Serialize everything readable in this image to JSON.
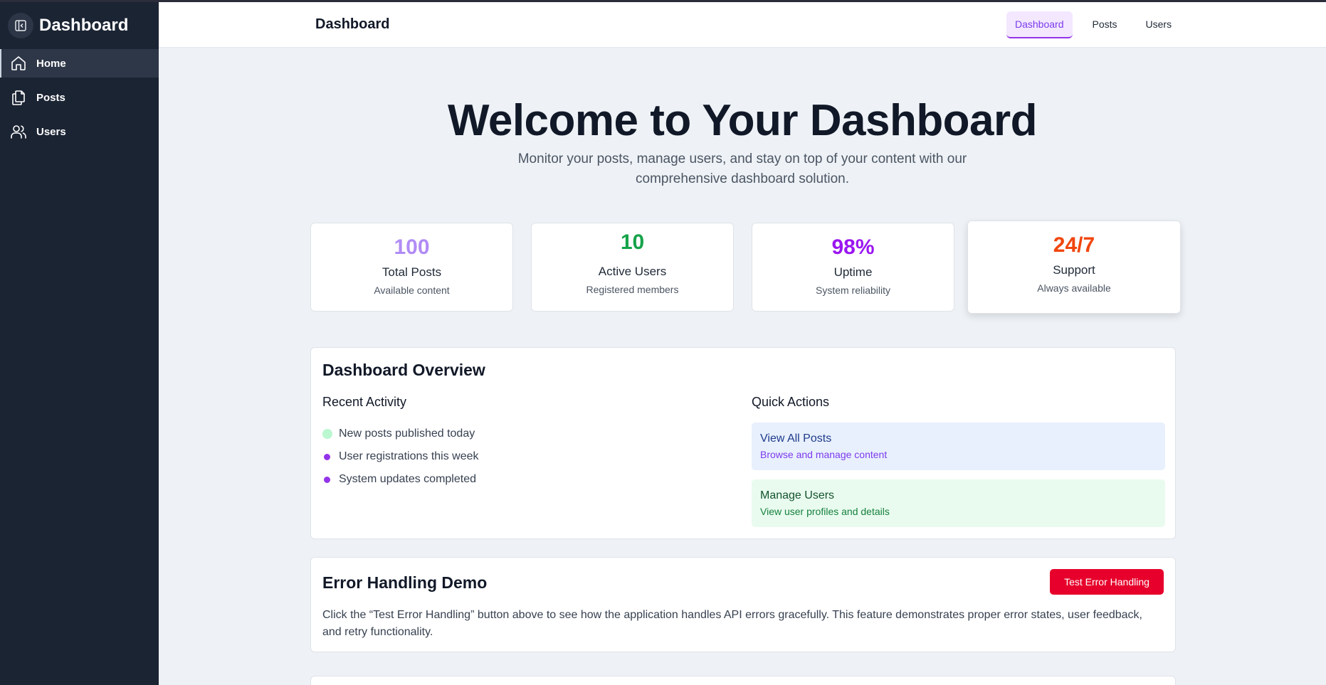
{
  "sidebar": {
    "title": "Dashboard",
    "items": [
      {
        "label": "Home",
        "icon": "home-icon",
        "active": true
      },
      {
        "label": "Posts",
        "icon": "files-icon",
        "active": false
      },
      {
        "label": "Users",
        "icon": "users-icon",
        "active": false
      }
    ]
  },
  "topbar": {
    "title": "Dashboard",
    "nav": [
      {
        "label": "Dashboard",
        "active": true
      },
      {
        "label": "Posts",
        "active": false
      },
      {
        "label": "Users",
        "active": false
      }
    ]
  },
  "hero": {
    "title": "Welcome to Your Dashboard",
    "subtitle": "Monitor your posts, manage users, and stay on top of your content with our comprehensive dashboard solution."
  },
  "stats": [
    {
      "value": "100",
      "label": "Total Posts",
      "desc": "Available content",
      "color": "#b18cf5"
    },
    {
      "value": "10",
      "label": "Active Users",
      "desc": "Registered members",
      "color": "#16a34a"
    },
    {
      "value": "98%",
      "label": "Uptime",
      "desc": "System reliability",
      "color": "#9b16f0"
    },
    {
      "value": "24/7",
      "label": "Support",
      "desc": "Always available",
      "color": "#f0460e"
    }
  ],
  "overview": {
    "title": "Dashboard Overview",
    "recent_title": "Recent Activity",
    "activity": [
      "New posts published today",
      "User registrations this week",
      "System updates completed"
    ],
    "quick_title": "Quick Actions",
    "actions": [
      {
        "title": "View All Posts",
        "desc": "Browse and manage content"
      },
      {
        "title": "Manage Users",
        "desc": "View user profiles and details"
      }
    ]
  },
  "error_demo": {
    "title": "Error Handling Demo",
    "button": "Test Error Handling",
    "text": "Click the “Test Error Handling” button above to see how the application handles API errors gracefully. This feature demonstrates proper error states, user feedback, and retry functionality."
  }
}
